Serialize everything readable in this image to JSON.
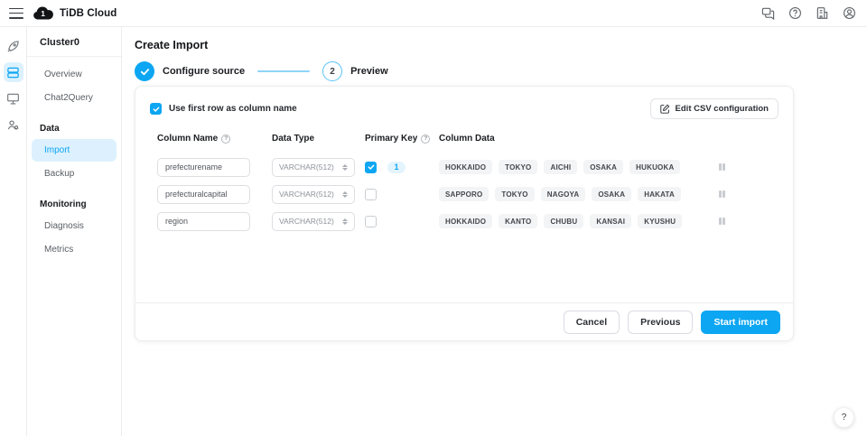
{
  "colors": {
    "accent": "#0ca6f2",
    "accent_light": "#dcf1fd",
    "badge_bg": "#e3f4fd",
    "chip_bg": "#f3f4f6"
  },
  "topbar": {
    "brand": "TiDB Cloud",
    "icons": [
      "menu-icon",
      "feedback-icon",
      "help-icon",
      "org-icon",
      "account-icon"
    ]
  },
  "rail": {
    "icons": [
      "rocket-icon",
      "database-icon",
      "monitor-icon",
      "people-icon"
    ],
    "active": "database-icon"
  },
  "sidebar": {
    "cluster_name": "Cluster0",
    "items": [
      {
        "label": "Overview",
        "type": "item",
        "active": false
      },
      {
        "label": "Chat2Query",
        "type": "item",
        "active": false
      },
      {
        "label": "Data",
        "type": "section"
      },
      {
        "label": "Import",
        "type": "item",
        "active": true
      },
      {
        "label": "Backup",
        "type": "item",
        "active": false
      },
      {
        "label": "Monitoring",
        "type": "section"
      },
      {
        "label": "Diagnosis",
        "type": "item",
        "active": false
      },
      {
        "label": "Metrics",
        "type": "item",
        "active": false
      }
    ]
  },
  "main": {
    "title": "Create Import",
    "stepper": {
      "step1": {
        "label": "Configure source",
        "state": "done"
      },
      "step2": {
        "number": "2",
        "label": "Preview",
        "state": "current"
      }
    },
    "card": {
      "use_first_row_label": "Use first row as column name",
      "use_first_row_checked": true,
      "edit_csv_label": "Edit CSV configuration",
      "headers": {
        "column_name": "Column Name",
        "data_type": "Data Type",
        "primary_key": "Primary Key",
        "column_data": "Column Data"
      },
      "rows": [
        {
          "name": "prefecturename",
          "type": "VARCHAR(512)",
          "primary_key": true,
          "pk_order": "1",
          "data": [
            "HOKKAIDO",
            "TOKYO",
            "AICHI",
            "OSAKA",
            "HUKUOKA"
          ]
        },
        {
          "name": "prefecturalcapital",
          "type": "VARCHAR(512)",
          "primary_key": false,
          "pk_order": "",
          "data": [
            "SAPPORO",
            "TOKYO",
            "NAGOYA",
            "OSAKA",
            "HAKATA"
          ]
        },
        {
          "name": "region",
          "type": "VARCHAR(512)",
          "primary_key": false,
          "pk_order": "",
          "data": [
            "HOKKAIDO",
            "KANTO",
            "CHUBU",
            "KANSAI",
            "KYUSHU"
          ]
        }
      ],
      "footer": {
        "cancel": "Cancel",
        "previous": "Previous",
        "start": "Start import"
      }
    }
  },
  "glyphs": {
    "question": "?"
  },
  "help_button": "?"
}
